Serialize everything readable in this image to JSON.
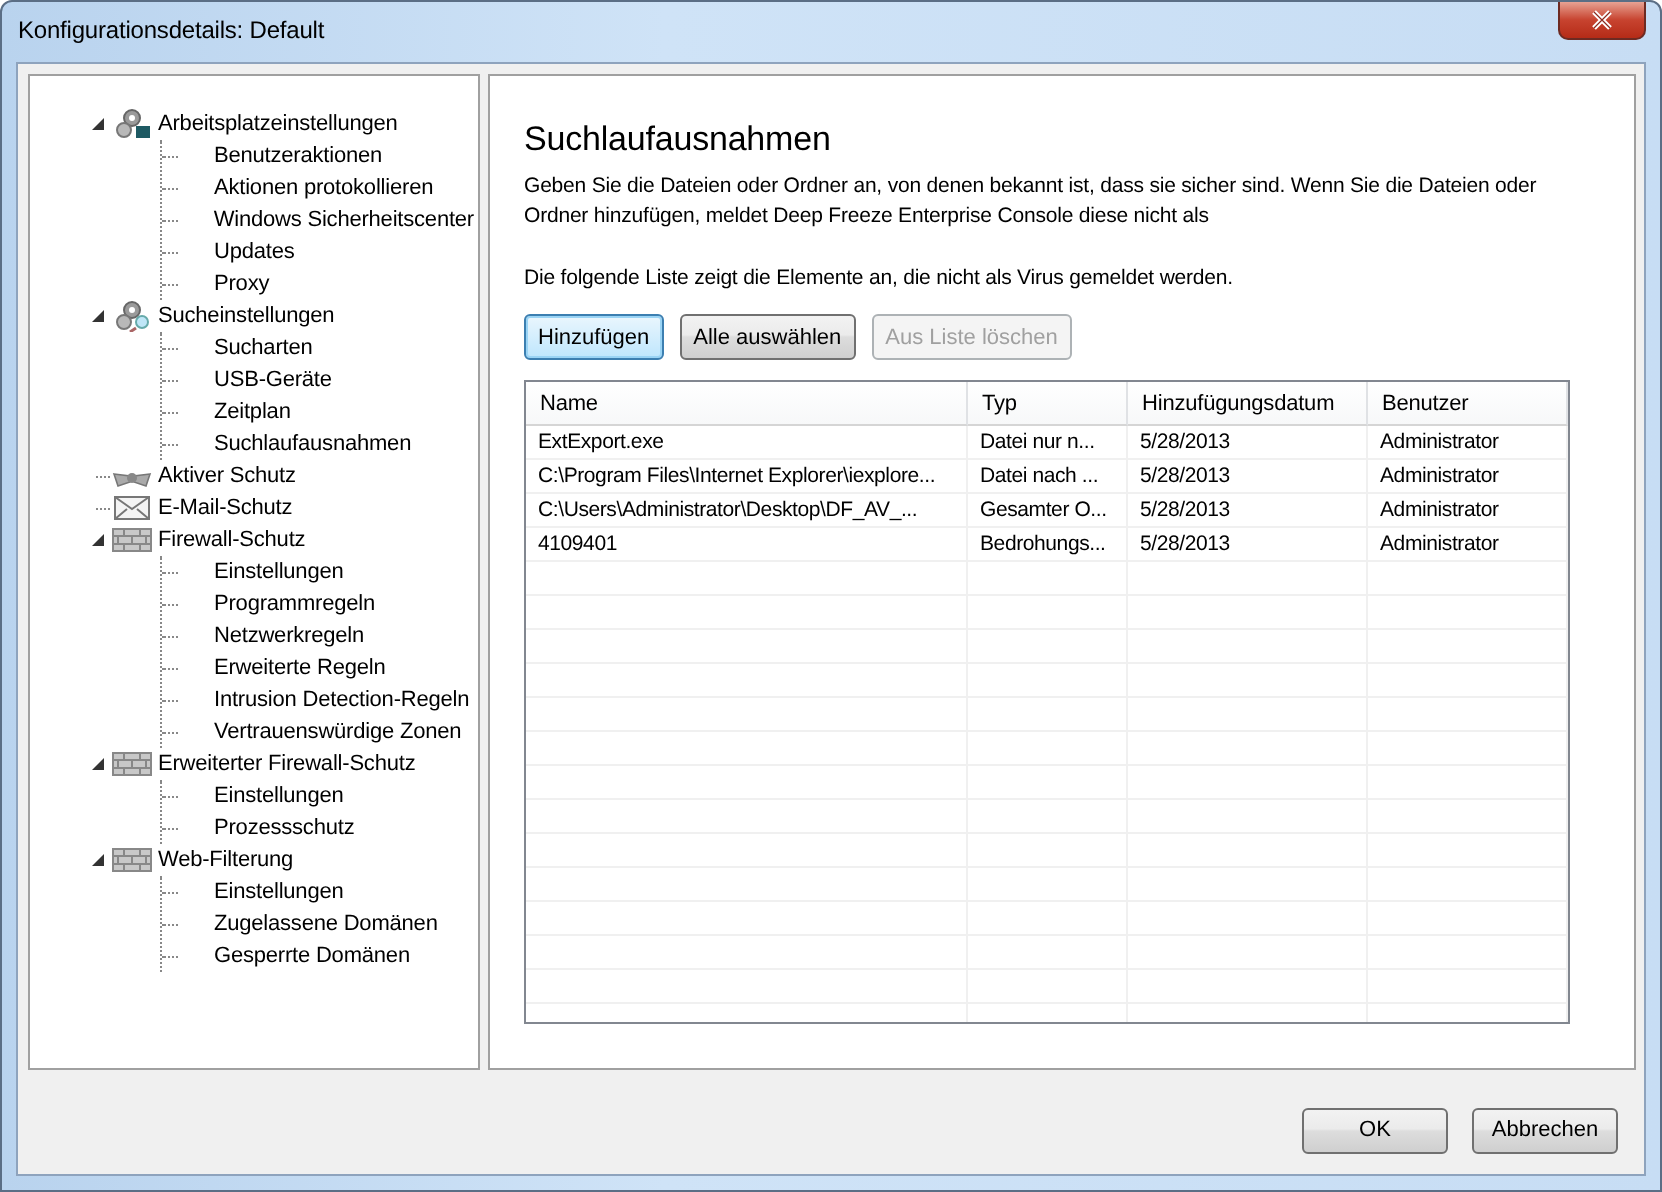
{
  "window": {
    "title": "Konfigurationsdetails: Default"
  },
  "tree": [
    {
      "label": "Arbeitsplatzeinstellungen",
      "kind": "gears",
      "expanded": true,
      "children": [
        {
          "label": "Benutzeraktionen"
        },
        {
          "label": "Aktionen protokollieren"
        },
        {
          "label": "Windows Sicherheitscenter"
        },
        {
          "label": "Updates"
        },
        {
          "label": "Proxy"
        }
      ]
    },
    {
      "label": "Sucheinstellungen",
      "kind": "search-gears",
      "expanded": true,
      "children": [
        {
          "label": "Sucharten"
        },
        {
          "label": "USB-Geräte"
        },
        {
          "label": "Zeitplan"
        },
        {
          "label": "Suchlaufausnahmen"
        }
      ]
    },
    {
      "label": "Aktiver Schutz",
      "kind": "wings"
    },
    {
      "label": "E-Mail-Schutz",
      "kind": "mail"
    },
    {
      "label": "Firewall-Schutz",
      "kind": "wall",
      "expanded": true,
      "children": [
        {
          "label": "Einstellungen"
        },
        {
          "label": "Programmregeln"
        },
        {
          "label": "Netzwerkregeln"
        },
        {
          "label": "Erweiterte Regeln"
        },
        {
          "label": "Intrusion Detection-Regeln"
        },
        {
          "label": "Vertrauenswürdige Zonen"
        }
      ]
    },
    {
      "label": "Erweiterter Firewall-Schutz",
      "kind": "wall",
      "expanded": true,
      "children": [
        {
          "label": "Einstellungen"
        },
        {
          "label": "Prozessschutz"
        }
      ]
    },
    {
      "label": "Web-Filterung",
      "kind": "wall",
      "expanded": true,
      "children": [
        {
          "label": "Einstellungen"
        },
        {
          "label": "Zugelassene Domänen"
        },
        {
          "label": "Gesperrte Domänen"
        }
      ]
    }
  ],
  "page": {
    "heading": "Suchlaufausnahmen",
    "description": "Geben Sie die Dateien oder Ordner an, von denen bekannt ist, dass sie sicher sind. Wenn Sie die Dateien oder Ordner hinzufügen, meldet Deep Freeze Enterprise Console diese nicht als",
    "list_note": "Die folgende Liste zeigt die Elemente an, die nicht als Virus gemeldet werden.",
    "buttons": [
      {
        "label": "Hinzufügen",
        "focused": true,
        "disabled": false
      },
      {
        "label": "Alle auswählen",
        "focused": false,
        "disabled": false
      },
      {
        "label": "Aus Liste löschen",
        "focused": false,
        "disabled": true
      }
    ],
    "table": {
      "columns": [
        "Name",
        "Typ",
        "Hinzufügungsdatum",
        "Benutzer"
      ],
      "rows": [
        [
          "ExtExport.exe",
          "Datei nur n...",
          "5/28/2013",
          "Administrator"
        ],
        [
          "C:\\Program Files\\Internet Explorer\\iexplore...",
          "Datei nach ...",
          "5/28/2013",
          "Administrator"
        ],
        [
          "C:\\Users\\Administrator\\Desktop\\DF_AV_...",
          "Gesamter O...",
          "5/28/2013",
          "Administrator"
        ],
        [
          "4109401",
          "Bedrohungs...",
          "5/28/2013",
          "Administrator"
        ]
      ]
    }
  },
  "footer_buttons": [
    {
      "label": "OK"
    },
    {
      "label": "Abbrechen"
    }
  ]
}
